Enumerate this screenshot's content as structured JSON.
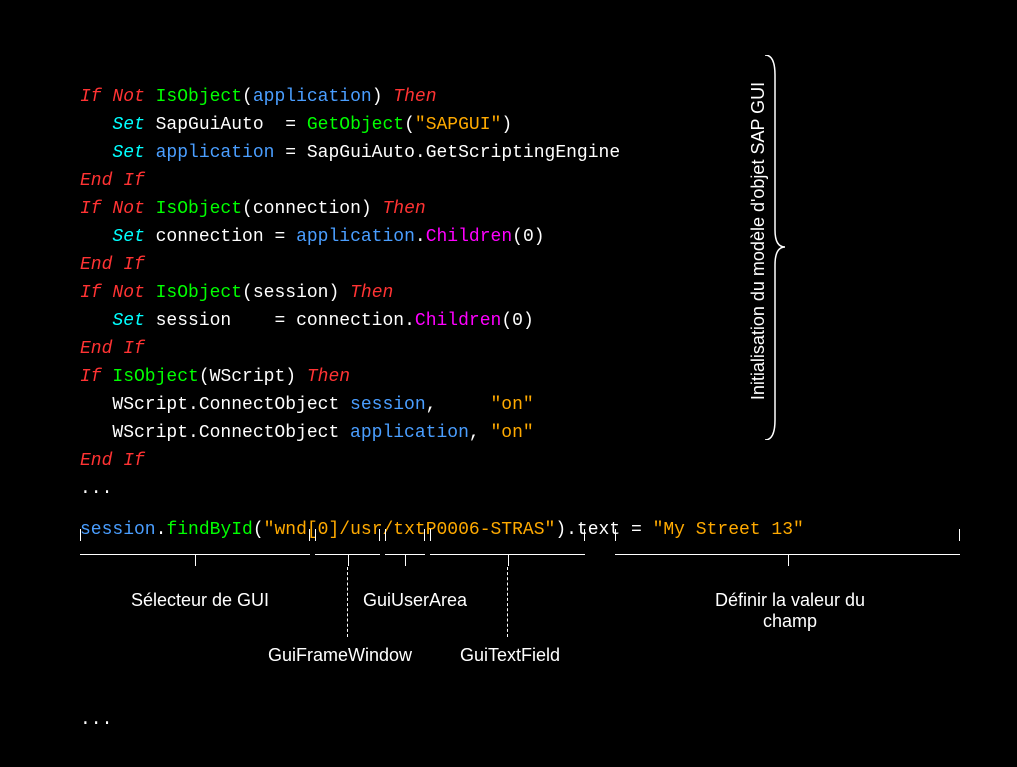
{
  "code": {
    "l1_if": "If ",
    "l1_not": "Not ",
    "l1_isobject": "IsObject",
    "l1_paren_open": "(",
    "l1_app": "application",
    "l1_paren_close": ") ",
    "l1_then": "Then",
    "l2_set": "   Set ",
    "l2_var": "SapGuiAuto  ",
    "l2_eq": "= ",
    "l2_getobj": "GetObject",
    "l2_paren": "(",
    "l2_str": "\"SAPGUI\"",
    "l2_close": ")",
    "l3_set": "   Set ",
    "l3_app": "application ",
    "l3_eq": "= ",
    "l3_rhs1": "SapGuiAuto",
    "l3_dot": ".",
    "l3_rhs2": "GetScriptingEngine",
    "l4_endif": "End If",
    "l5_if": "If ",
    "l5_not": "Not ",
    "l5_isobject": "IsObject",
    "l5_po": "(",
    "l5_conn": "connection",
    "l5_pc": ") ",
    "l5_then": "Then",
    "l6_set": "   Set ",
    "l6_conn": "connection ",
    "l6_eq": "= ",
    "l6_app": "application",
    "l6_dot": ".",
    "l6_children": "Children",
    "l6_po": "(",
    "l6_zero": "0",
    "l6_pc": ")",
    "l7_endif": "End If",
    "l8_if": "If ",
    "l8_not": "Not ",
    "l8_isobject": "IsObject",
    "l8_po": "(",
    "l8_sess": "session",
    "l8_pc": ") ",
    "l8_then": "Then",
    "l9_set": "   Set ",
    "l9_sess": "session    ",
    "l9_eq": "= ",
    "l9_conn": "connection",
    "l9_dot": ".",
    "l9_children": "Children",
    "l9_po": "(",
    "l9_zero": "0",
    "l9_pc": ")",
    "l10_endif": "End If",
    "l11_if": "If ",
    "l11_isobject": "IsObject",
    "l11_po": "(",
    "l11_ws": "WScript",
    "l11_pc": ") ",
    "l11_then": "Then",
    "l12_txt": "   WScript.ConnectObject ",
    "l12_sess": "session",
    "l12_comma": ",     ",
    "l12_on": "\"on\"",
    "l13_txt": "   WScript.ConnectObject ",
    "l13_app": "application",
    "l13_comma": ", ",
    "l13_on": "\"on\"",
    "l14_endif": "End If",
    "l15_dots": "..."
  },
  "stmt": {
    "session": "session",
    "dot1": ".",
    "findById": "findById",
    "po": "(",
    "str": "\"wnd[0]/usr/txtP0006-STRAS\"",
    "pc": ")",
    "dot2": ".",
    "text": "text ",
    "eq": "= ",
    "val": "\"My Street 13\""
  },
  "labels": {
    "vertical": "Initialisation du modèle d'objet\nSAP GUI",
    "gui_selector": "Sélecteur de GUI",
    "gui_frame": "GuiFrameWindow",
    "gui_user": "GuiUserArea",
    "gui_text": "GuiTextField",
    "set_value": "Définir la valeur du\nchamp"
  },
  "bottom_dots": "..."
}
